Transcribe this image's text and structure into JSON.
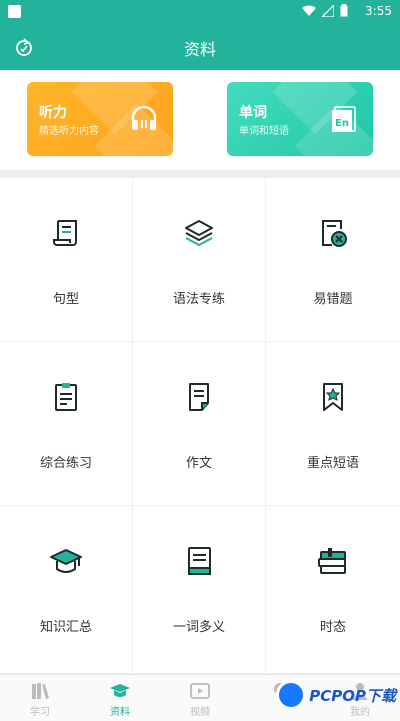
{
  "status": {
    "time": "3:55"
  },
  "header": {
    "title": "资料"
  },
  "cards": [
    {
      "title": "听力",
      "subtitle": "精选听力内容",
      "icon": "headphones-icon",
      "color": "#ffa31a"
    },
    {
      "title": "单词",
      "subtitle": "单词和短语",
      "icon": "en-dictionary-icon",
      "color": "#1ec7a6"
    }
  ],
  "grid": [
    {
      "label": "句型",
      "icon": "scroll-icon"
    },
    {
      "label": "语法专练",
      "icon": "layers-icon"
    },
    {
      "label": "易错题",
      "icon": "wrong-doc-icon"
    },
    {
      "label": "综合练习",
      "icon": "clipboard-icon"
    },
    {
      "label": "作文",
      "icon": "document-icon"
    },
    {
      "label": "重点短语",
      "icon": "bookmark-star-icon"
    },
    {
      "label": "知识汇总",
      "icon": "graduation-cap-icon"
    },
    {
      "label": "一词多义",
      "icon": "book-icon"
    },
    {
      "label": "时态",
      "icon": "books-stack-icon"
    }
  ],
  "tabs": [
    {
      "label": "学习",
      "icon": "books-icon"
    },
    {
      "label": "资料",
      "icon": "graduation-cap-icon",
      "active": true
    },
    {
      "label": "视频",
      "icon": "video-icon"
    },
    {
      "label": "",
      "icon": "bulb-icon"
    },
    {
      "label": "我的",
      "icon": "user-icon"
    }
  ],
  "watermark": {
    "text": "PCPOP下载"
  },
  "colors": {
    "primary": "#23b39b",
    "orange": "#ffa31a",
    "teal": "#1ec7a6"
  }
}
